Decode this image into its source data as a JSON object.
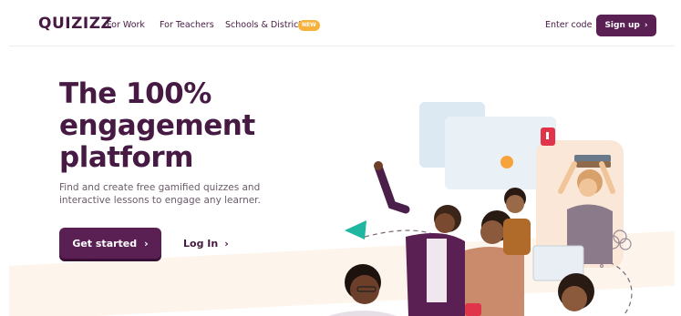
{
  "header": {
    "logo": "QUIZIZZ",
    "nav": [
      "For Work",
      "For Teachers",
      "Schools & Districts"
    ],
    "badge": "NEW",
    "enter_code": "Enter code",
    "signup": "Sign up"
  },
  "hero": {
    "headline": [
      "The 100%",
      "engagement",
      "platform"
    ],
    "subtext": "Find and create free gamified quizzes and interactive lessons to engage any learner.",
    "get_started": "Get started",
    "login": "Log In"
  },
  "icons": {
    "chevron": "›"
  },
  "colors": {
    "brand": "#461a42",
    "button": "#5a1f53",
    "badge": "#f7b23b",
    "accent_teal": "#1fb7a1",
    "accent_red": "#e0344a"
  }
}
